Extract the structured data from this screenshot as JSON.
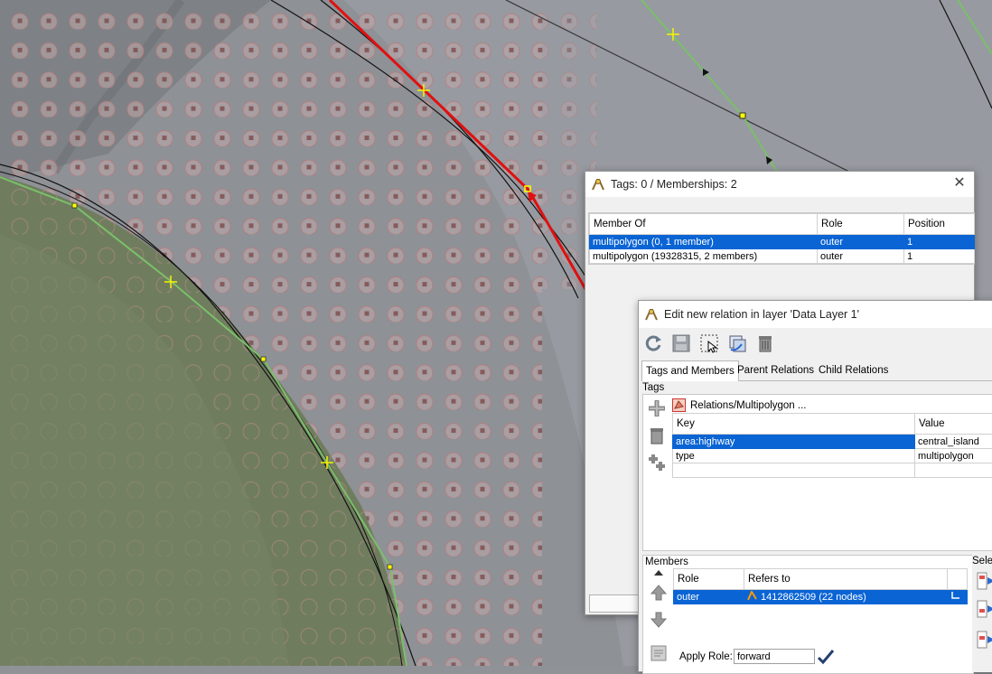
{
  "memberships_dialog": {
    "title": "Tags: 0 / Memberships: 2",
    "columns": [
      "Member Of",
      "Role",
      "Position"
    ],
    "rows": [
      {
        "member_of": "multipolygon (0, 1 member)",
        "role": "outer",
        "position": "1"
      },
      {
        "member_of": "multipolygon (19328315, 2 members)",
        "role": "outer",
        "position": "1"
      }
    ]
  },
  "relation_editor": {
    "title": "Edit new relation in layer 'Data Layer 1'",
    "tabs": [
      "Tags and Members",
      "Parent Relations",
      "Child Relations"
    ],
    "tags_section_label": "Tags",
    "preset_label": "Relations/Multipolygon ...",
    "tag_columns": [
      "Key",
      "Value"
    ],
    "tags": [
      {
        "key": "area:highway",
        "value": "central_island"
      },
      {
        "key": "type",
        "value": "multipolygon"
      }
    ],
    "members_section_label": "Members",
    "member_columns": [
      "Role",
      "Refers to"
    ],
    "members": [
      {
        "role": "outer",
        "refers_to": "1412862509 (22 nodes)"
      }
    ],
    "selection_label": "Selec",
    "apply_role_label": "Apply Role:",
    "apply_role_value": "forward"
  }
}
